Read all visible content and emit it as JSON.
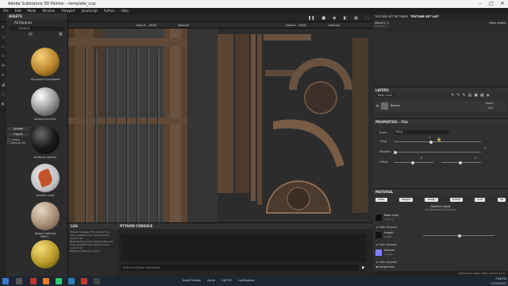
{
  "window": {
    "title": "Adobe Substance 3D Painter - template_cup",
    "min": "–",
    "max": "□",
    "close": "✕"
  },
  "menu": [
    "File",
    "Edit",
    "Mode",
    "Window",
    "Viewport",
    "JavaScript",
    "Python",
    "Help"
  ],
  "assets": {
    "title": "ASSETS",
    "filter": "All libraries",
    "search": "SEARCH",
    "items": [
      "Aluminium Anodized",
      "Aluminium Pure",
      "Artificial Leather",
      "Autumn Leaf",
      "Baked Lighting Mate..."
    ],
    "side": {
      "update": "Update",
      "export": "Export",
      "checks": [
        "Unless",
        "Default 3D"
      ]
    }
  },
  "viewport3d": {
    "channel": "Default - sRGB",
    "mode": "Material"
  },
  "viewport2d": {
    "channel": "Default - sRGB",
    "mode": "Material"
  },
  "textureset": {
    "tab1": "TEXTURE SET SETTINGS",
    "tab2": "TEXTURE SET LIST",
    "rows": [
      {
        "name": "Mesh01_0",
        "shader": "Main shader"
      },
      {
        "name": "Mesh01_1",
        "shader": ""
      }
    ]
  },
  "layers": {
    "title": "LAYERS",
    "blend": "Base color",
    "layer_name": "Bakers",
    "layer_mode": "Norm",
    "layer_opacity": "100"
  },
  "properties": {
    "title": "PROPERTIES - FILL",
    "scale_label": "Scale",
    "scale_value": "Tiling",
    "tiling_label": "Tiling",
    "tiling_value": "1",
    "rotation_label": "Rotation",
    "rotation_value": "0",
    "offset_label": "Offset",
    "offset_x": "0",
    "offset_y": "0"
  },
  "material": {
    "title": "MATERIAL",
    "buttons": [
      "color",
      "height",
      "rough",
      "metal",
      "nrm",
      "ao"
    ],
    "mode_title": "Material mode",
    "mode_value": "No Resource Selected",
    "base_color": "Base color",
    "base_color_sub": "uniform",
    "spaces": [
      "Color Spaces",
      "Color Spaces",
      "Color Spaces"
    ],
    "height": "Height",
    "height_sub": "height",
    "normal": "Normal",
    "normal_sub": "normal",
    "roughness": "Roughness"
  },
  "log": {
    "title": "LOG",
    "lines": [
      "[Plugin Manager] The project has been updated from version 10 to version 10",
      "[Baking Document] Baking data has been updated from version 12 to version 13",
      "[Python] Failed to import"
    ]
  },
  "python": {
    "title": "PYTHON CONSOLE",
    "placeholder": "Execute Python command..."
  },
  "status": {
    "left": "Cache Disk Usage: 48% | Version 8.3.0"
  },
  "taskbar": {
    "items": [
      "Asset Tracker",
      "Azure",
      "SAP GC",
      "myDropbox"
    ],
    "time": "7:06 PM",
    "date": "17/05/2023"
  }
}
